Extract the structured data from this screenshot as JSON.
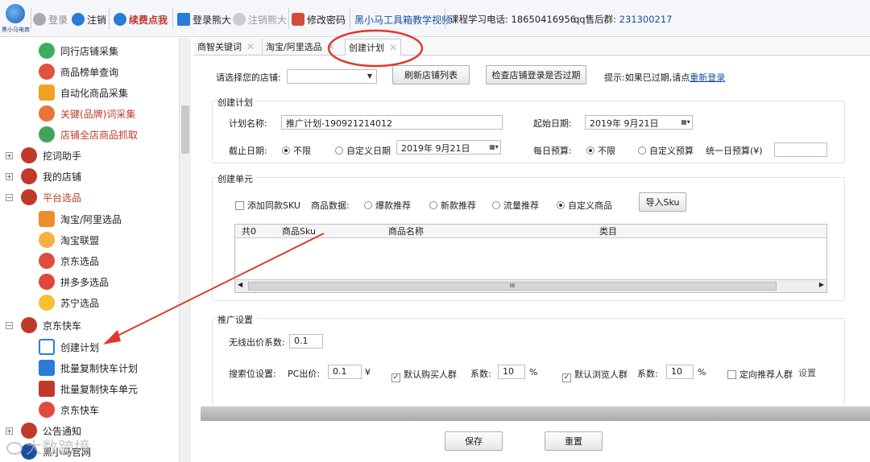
{
  "toolbar": {
    "logo_text": "黑小马电商",
    "login": "登录",
    "logout": "注销",
    "renew": "续费点我",
    "login_jd": "登录熊大",
    "logout_jd": "注销熊大",
    "change_pwd": "修改密码",
    "tutorial": "黑小马工具箱教学视频",
    "phone_label": "课程学习电话:",
    "phone": "18650416956",
    "qq_label": "qq售后群:",
    "qq": "231300217"
  },
  "sidebar": {
    "items": [
      {
        "label": "同行店铺采集"
      },
      {
        "label": "商品榜单查询"
      },
      {
        "label": "自动化商品采集"
      },
      {
        "label": "关键(品牌)词采集"
      },
      {
        "label": "店铺全店商品抓取"
      },
      {
        "label": "挖词助手",
        "toggle": "+"
      },
      {
        "label": "我的店铺",
        "toggle": "+"
      },
      {
        "label": "平台选品",
        "toggle": "−"
      },
      {
        "label": "淘宝/阿里选品"
      },
      {
        "label": "淘宝联盟"
      },
      {
        "label": "京东选品"
      },
      {
        "label": "拼多多选品"
      },
      {
        "label": "苏宁选品"
      },
      {
        "label": "京东快车",
        "toggle": "−"
      },
      {
        "label": "创建计划"
      },
      {
        "label": "批量复制快车计划"
      },
      {
        "label": "批量复制快车单元"
      },
      {
        "label": "京东快车"
      },
      {
        "label": "公告通知",
        "toggle": "+"
      },
      {
        "label": "黑小马官网"
      }
    ]
  },
  "tabs": [
    {
      "label": "商智关键词"
    },
    {
      "label": "淘宝/阿里选品"
    },
    {
      "label": "创建计划"
    }
  ],
  "shop": {
    "label": "请选择您的店铺:",
    "value": "",
    "refresh_button": "刷新店铺列表",
    "check_button": "检查店铺登录是否过期",
    "hint": "提示:如果已过期,请点",
    "relogin_link": "重新登录"
  },
  "plan": {
    "title": "创建计划",
    "name_label": "计划名称:",
    "name_value": "推广计划-190921214012",
    "start_label": "起始日期:",
    "start_value": "2019年 9月21日",
    "end_label": "截止日期:",
    "end_unlimited": "不限",
    "end_custom": "自定义日期",
    "end_value": "2019年 9月21日",
    "budget_label": "每日预算:",
    "budget_unlimited": "不限",
    "budget_custom": "自定义预算",
    "uniform_label": "统一日预算(¥)",
    "uniform_value": ""
  },
  "unit": {
    "title": "创建单元",
    "add_sku": "添加同款SKU",
    "data_label": "商品数据:",
    "options": [
      "爆款推荐",
      "新款推荐",
      "流量推荐",
      "自定义商品"
    ],
    "import_button": "导入Sku",
    "columns": [
      "共0",
      "商品Sku",
      "商品名称",
      "类目"
    ],
    "scroll_grip": "III"
  },
  "promo": {
    "title": "推广设置",
    "wireless_label": "无线出价系数:",
    "wireless_value": "0.1",
    "search_label": "搜索位设置:",
    "pc_label": "PC出价:",
    "pc_value": "0.1",
    "currency": "¥",
    "buyer_label": "默认购买人群",
    "buyer_coef_label": "系数:",
    "buyer_coef": "10",
    "percent": "%",
    "browse_label": "默认浏览人群",
    "browse_coef_label": "系数:",
    "browse_coef": "10",
    "targeted_label": "定向推荐人群",
    "settings_link": "设置"
  },
  "footer": {
    "save_button": "保存",
    "reset_button": "重置"
  },
  "watermark": "大数跨境",
  "colors": {
    "annotation": "#e0392b",
    "link": "#1a4fa0",
    "accent_red": "#c0392b"
  }
}
